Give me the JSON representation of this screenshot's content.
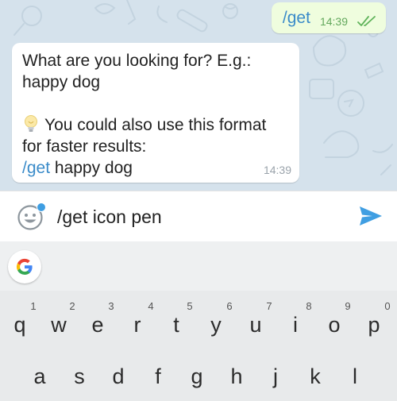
{
  "chat": {
    "outgoing": {
      "text": "/get",
      "time": "14:39",
      "status_icon": "double-check-icon"
    },
    "incoming": {
      "line1": "What are you looking for? E.g.:",
      "line2": "happy dog",
      "tip_icon": "lightbulb-icon",
      "line3": "You could also use this format",
      "line4": "for faster results:",
      "example_cmd": "/get",
      "example_rest": " happy dog",
      "time": "14:39"
    }
  },
  "input": {
    "value": "/get icon pen",
    "emoji_icon": "emoji-face-icon",
    "send_icon": "send-icon"
  },
  "keyboard": {
    "suggestion_icon": "google-g-icon",
    "row1": [
      {
        "hint": "1",
        "key": "q"
      },
      {
        "hint": "2",
        "key": "w"
      },
      {
        "hint": "3",
        "key": "e"
      },
      {
        "hint": "4",
        "key": "r"
      },
      {
        "hint": "5",
        "key": "t"
      },
      {
        "hint": "6",
        "key": "y"
      },
      {
        "hint": "7",
        "key": "u"
      },
      {
        "hint": "8",
        "key": "i"
      },
      {
        "hint": "9",
        "key": "o"
      },
      {
        "hint": "0",
        "key": "p"
      }
    ],
    "row2": [
      {
        "key": "a"
      },
      {
        "key": "s"
      },
      {
        "key": "d"
      },
      {
        "key": "f"
      },
      {
        "key": "g"
      },
      {
        "key": "h"
      },
      {
        "key": "j"
      },
      {
        "key": "k"
      },
      {
        "key": "l"
      }
    ]
  },
  "colors": {
    "accent": "#3a8bc9",
    "outgoing_bubble": "#effdde",
    "chat_bg": "#d5e2ec",
    "keyboard_bg": "#e8eaeb"
  }
}
